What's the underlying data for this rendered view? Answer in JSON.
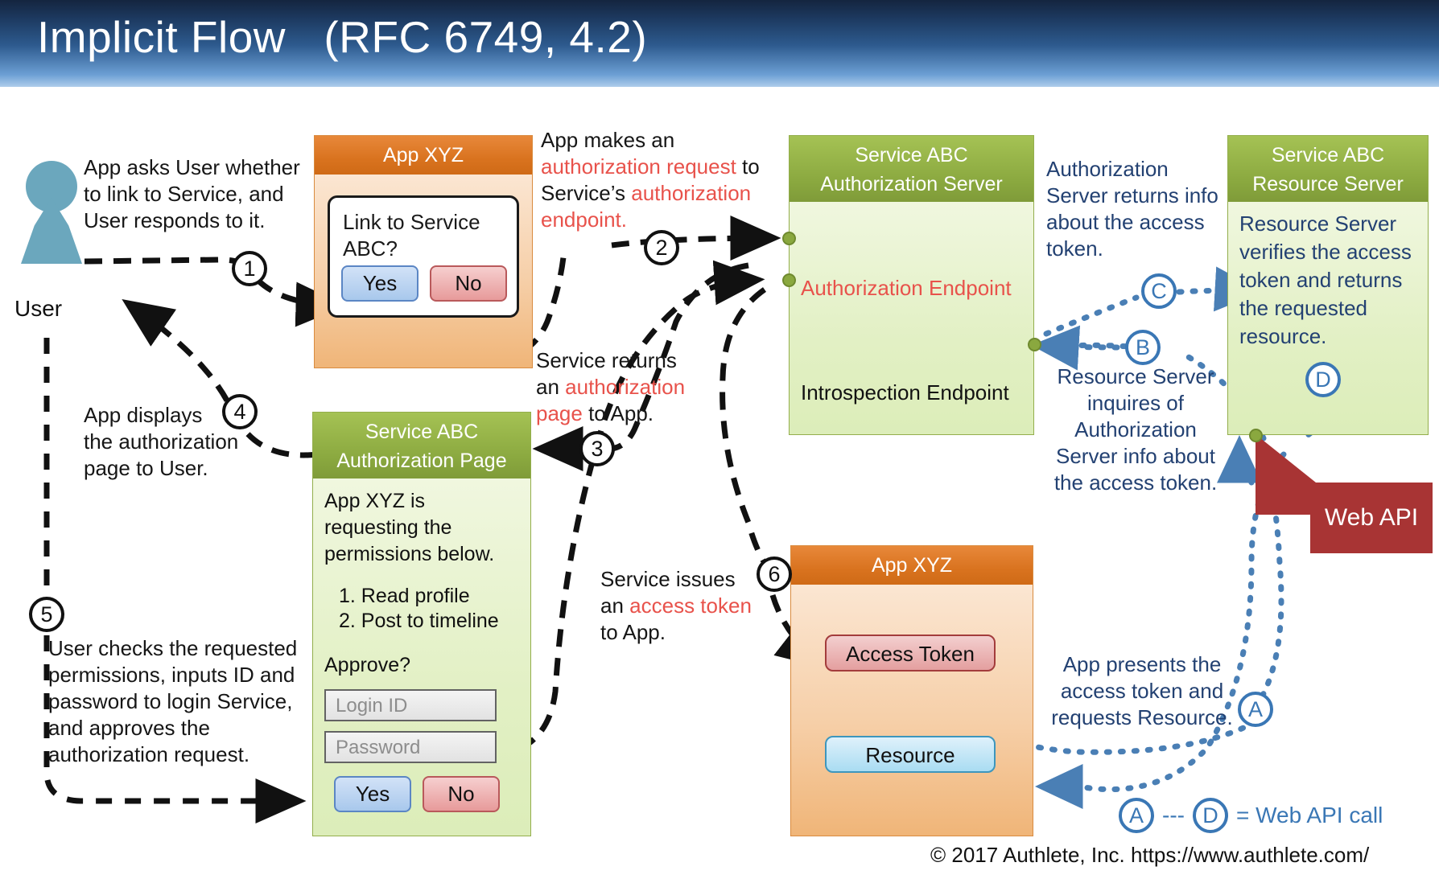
{
  "title": "Implicit Flow   (RFC 6749, 4.2)",
  "actors": {
    "user_label": "User"
  },
  "app_top": {
    "header": "App XYZ",
    "dialog_text": "Link to Service ABC?",
    "yes": "Yes",
    "no": "No"
  },
  "auth_server": {
    "header_line1": "Service ABC",
    "header_line2": "Authorization Server",
    "endpoint_authorization": "Authorization Endpoint",
    "endpoint_introspection": "Introspection Endpoint"
  },
  "resource_server": {
    "header_line1": "Service ABC",
    "header_line2": "Resource Server",
    "body": "Resource Server verifies the access token and returns the requested resource."
  },
  "auth_page": {
    "header_line1": "Service ABC",
    "header_line2": "Authorization Page",
    "intro": "App XYZ is requesting the permissions below.",
    "permissions": [
      "1. Read profile",
      "2. Post to timeline"
    ],
    "approve_label": "Approve?",
    "login_id_placeholder": "Login ID",
    "password_placeholder": "Password",
    "yes": "Yes",
    "no": "No"
  },
  "app_bottom": {
    "header": "App XYZ",
    "access_token": "Access Token",
    "resource": "Resource"
  },
  "web_api": {
    "label": "Web API"
  },
  "annotations": {
    "a1_l1": "App asks User whether",
    "a1_l2": "to link to Service, and",
    "a1_l3": "User responds to it.",
    "a2_l1": "App makes an",
    "a2_l2a": "authorization request",
    "a2_l2b": " to",
    "a2_l3a": "Service’s ",
    "a2_l3b": "authorization",
    "a2_l4a": "endpoint",
    "a2_l4b": ".",
    "a3_l1": "Service returns",
    "a3_l2a": "an ",
    "a3_l2b": "authorization",
    "a3_l3a": "page",
    "a3_l3b": " to App.",
    "a4_l1": "App displays",
    "a4_l2": "the authorization",
    "a4_l3": "page to User.",
    "a5_l1": "User checks the requested",
    "a5_l2": "permissions, inputs ID and",
    "a5_l3": "password to login Service,",
    "a5_l4": "and approves the",
    "a5_l5": "authorization request.",
    "a6_l1": "Service issues",
    "a6_l2a": "an ",
    "a6_l2b": "access token",
    "a6_l3": "to App.",
    "b_authinfo": "Authorization Server returns info about the access token.",
    "b_inquires": "Resource Server inquires of Authorization Server info about the access token.",
    "b_presents": "App presents the access token and requests Resource."
  },
  "steps": [
    "1",
    "2",
    "3",
    "4",
    "5",
    "6"
  ],
  "letters": [
    "A",
    "B",
    "C",
    "D"
  ],
  "legend": {
    "a": "A",
    "dashes": "---",
    "d": "D",
    "text": "= Web API call"
  },
  "footer": "© 2017 Authlete, Inc.  https://www.authlete.com/",
  "colors": {
    "title_bar_dark": "#14253f",
    "title_bar_light": "#aecdeb",
    "highlight_red": "#e8524b",
    "annotation_blue": "#234172",
    "accent_blue": "#3a77b5",
    "green_header": "#8aa83f",
    "green_body": "#e2f0c4",
    "orange_header": "#d9731f",
    "orange_body": "#f6cfa8",
    "webapi_red": "#a83434",
    "user_teal": "#6ba7bd"
  }
}
